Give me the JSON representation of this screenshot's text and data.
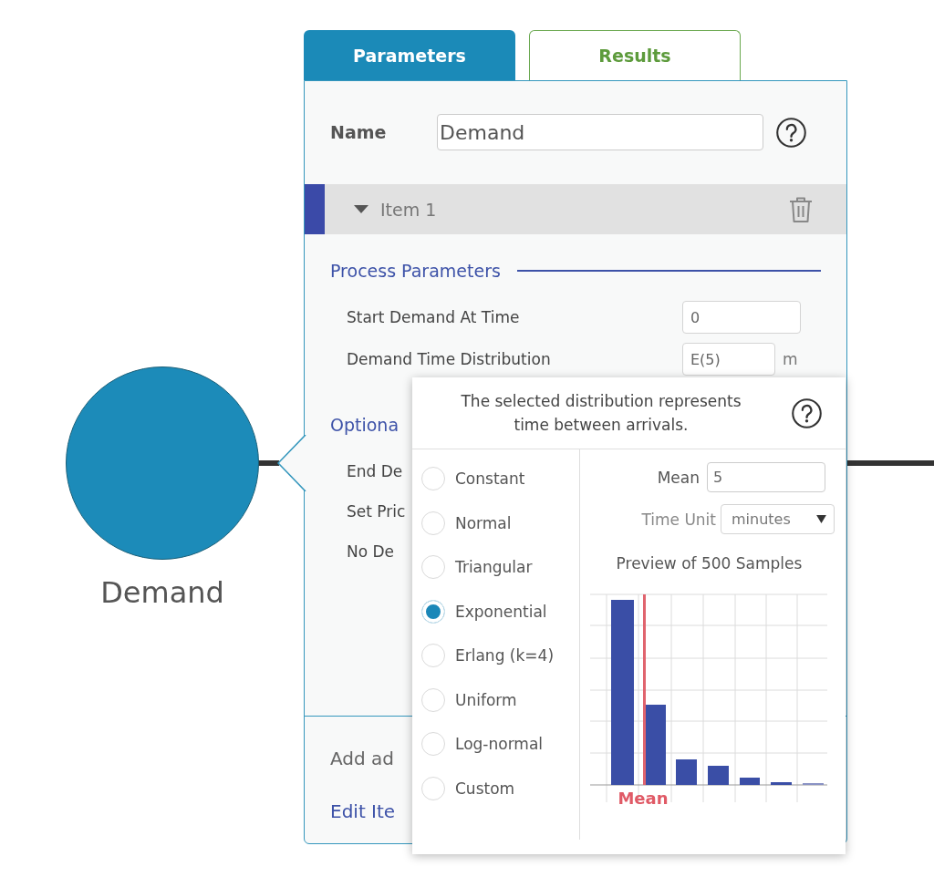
{
  "canvas": {
    "node": {
      "label": "Demand"
    }
  },
  "tabs": [
    {
      "label": "Parameters",
      "selected": true
    },
    {
      "label": "Results",
      "selected": false
    }
  ],
  "panel": {
    "name": {
      "label": "Name",
      "value": "Demand"
    },
    "item": {
      "title": "Item 1",
      "expanded": true
    },
    "sections": [
      {
        "title": "Process Parameters",
        "rows": [
          {
            "label": "Start Demand At Time",
            "value": "0"
          },
          {
            "label": "Demand Time Distribution",
            "value": "E(5)",
            "unit": "m"
          }
        ]
      },
      {
        "title": "Optiona",
        "rows": [
          {
            "label": "End De"
          },
          {
            "label": "Set Pric"
          },
          {
            "label": "No De"
          }
        ]
      }
    ],
    "footer": [
      {
        "kind": "text",
        "label": "Add ad"
      },
      {
        "kind": "link",
        "label": "Edit Ite"
      }
    ]
  },
  "popup": {
    "description": "The selected distribution represents time between arrivals.",
    "distributions": [
      {
        "label": "Constant",
        "selected": false
      },
      {
        "label": "Normal",
        "selected": false
      },
      {
        "label": "Triangular",
        "selected": false
      },
      {
        "label": "Exponential",
        "selected": true
      },
      {
        "label": "Erlang (k=4)",
        "selected": false
      },
      {
        "label": "Uniform",
        "selected": false
      },
      {
        "label": "Log-normal",
        "selected": false
      },
      {
        "label": "Custom",
        "selected": false
      }
    ],
    "mean": {
      "label": "Mean",
      "value": "5"
    },
    "time_unit": {
      "label": "Time Unit",
      "value": "minutes"
    },
    "preview": {
      "title": "Preview of 500 Samples",
      "mean_label": "Mean"
    }
  }
}
